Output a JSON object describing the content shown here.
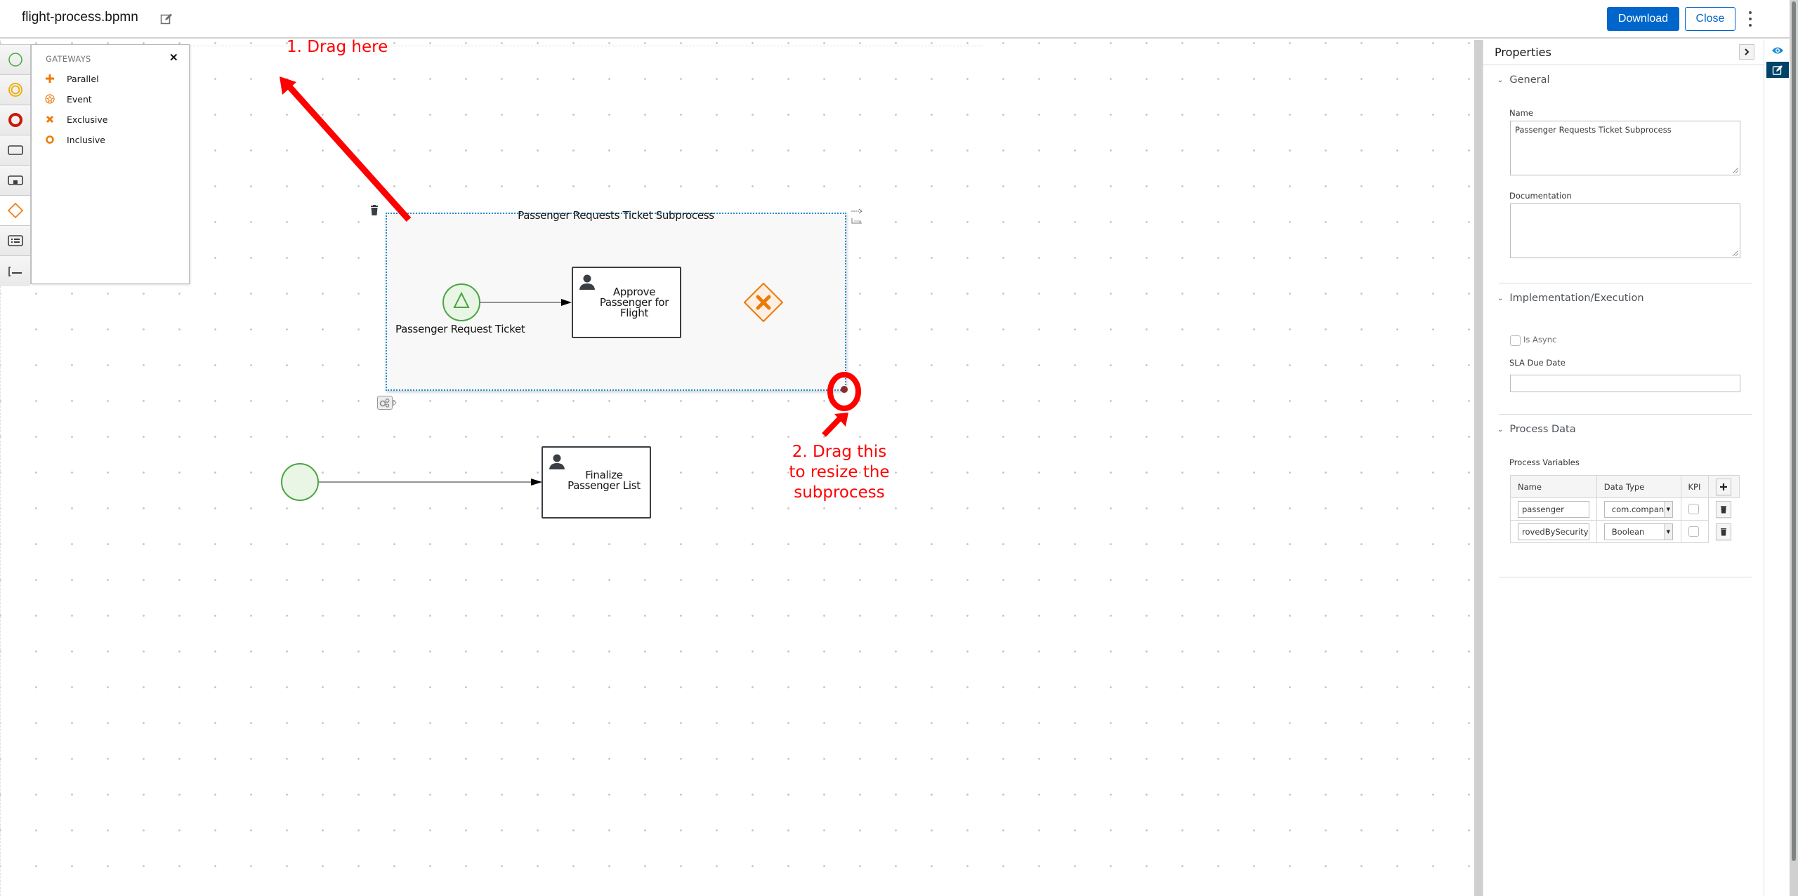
{
  "header": {
    "file_name": "flight-process.bpmn",
    "edit_icon": "pencil-square-icon",
    "download_label": "Download",
    "close_label": "Close",
    "more_icon": "kebab-vertical-icon"
  },
  "palette": {
    "items": [
      {
        "name": "start-events",
        "icon": "circle-green-icon"
      },
      {
        "name": "intermediate-events",
        "icon": "double-circle-yellow-icon"
      },
      {
        "name": "end-events",
        "icon": "thick-circle-red-icon"
      },
      {
        "name": "activities",
        "icon": "rectangle-icon"
      },
      {
        "name": "subprocesses",
        "icon": "subprocess-rectangle-icon"
      },
      {
        "name": "gateways",
        "icon": "diamond-orange-icon",
        "active": true
      },
      {
        "name": "containers",
        "icon": "lane-list-icon"
      },
      {
        "name": "artifacts",
        "icon": "text-annotation-icon"
      }
    ],
    "flyout": {
      "title": "GATEWAYS",
      "close_icon": "close-x-icon",
      "items": [
        {
          "label": "Parallel",
          "icon": "plus-icon"
        },
        {
          "label": "Event",
          "icon": "star-circle-icon"
        },
        {
          "label": "Exclusive",
          "icon": "x-icon"
        },
        {
          "label": "Inclusive",
          "icon": "circle-icon"
        }
      ]
    }
  },
  "diagram": {
    "subprocess": {
      "title": "Passenger Requests Ticket Subprocess",
      "start_event_label": "Passenger Request Ticket",
      "task_label_lines": [
        "Approve",
        "Passenger for",
        "Flight"
      ],
      "gateway": "exclusive-gateway"
    },
    "main": {
      "task_label_lines": [
        "Finalize",
        "Passenger List"
      ]
    },
    "annotations": {
      "step1": "1. Drag here",
      "step2_lines": [
        "2. Drag this",
        "to resize the",
        "subprocess"
      ]
    },
    "colors": {
      "start_event": "#4aa541",
      "gateway": "#ec7a08",
      "selection": "#1a8ccf",
      "annotation": "#ff0000"
    }
  },
  "properties": {
    "title": "Properties",
    "collapse_icon": "chevron-right-icon",
    "sections": {
      "general": {
        "label": "General",
        "name_label": "Name",
        "name_value": "Passenger Requests Ticket Subprocess",
        "documentation_label": "Documentation",
        "documentation_value": ""
      },
      "implementation": {
        "label": "Implementation/Execution",
        "is_async_label": "Is Async",
        "is_async_checked": false,
        "sla_label": "SLA Due Date",
        "sla_value": ""
      },
      "process_data": {
        "label": "Process Data",
        "variables_label": "Process Variables",
        "columns": [
          "Name",
          "Data Type",
          "KPI"
        ],
        "rows": [
          {
            "name": "passenger",
            "type": "com.company",
            "kpi": false
          },
          {
            "name": "rovedBySecurity",
            "type": "Boolean",
            "kpi": false
          }
        ]
      }
    }
  },
  "side_strip": {
    "view_icon": "eye-icon",
    "edit_icon": "edit-properties-icon"
  }
}
